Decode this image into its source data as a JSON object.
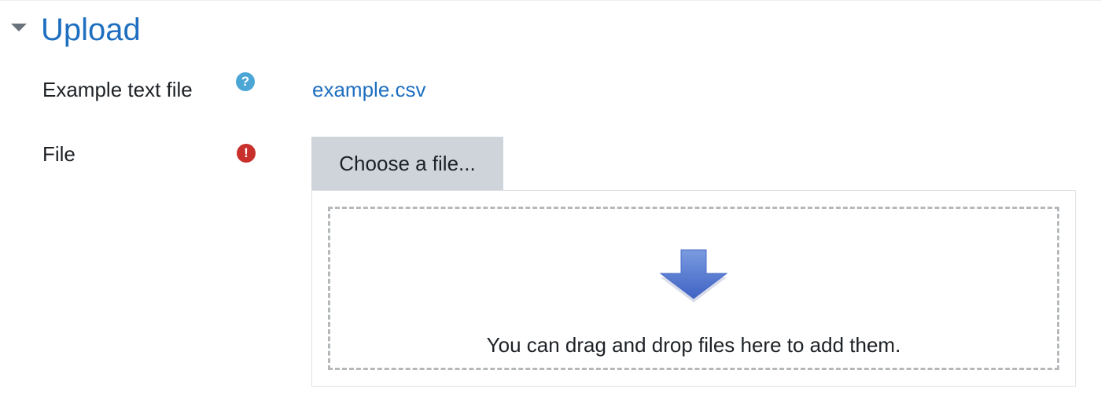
{
  "section": {
    "title": "Upload",
    "toggle_icon": "caret-down-icon"
  },
  "example_row": {
    "label": "Example text file",
    "help_icon_glyph": "?",
    "help_icon": "help-icon",
    "link_text": "example.csv"
  },
  "file_row": {
    "label": "File",
    "required_icon_glyph": "!",
    "required_icon": "required-icon",
    "choose_button_label": "Choose a file...",
    "dropzone_text": "You can drag and drop files here to add them.",
    "dropzone_icon": "down-arrow-icon"
  },
  "colors": {
    "link": "#1f6fc0",
    "help": "#4ba6d6",
    "required": "#c9302c",
    "button_bg": "#ced4da",
    "arrow": "#5b7fd0"
  }
}
